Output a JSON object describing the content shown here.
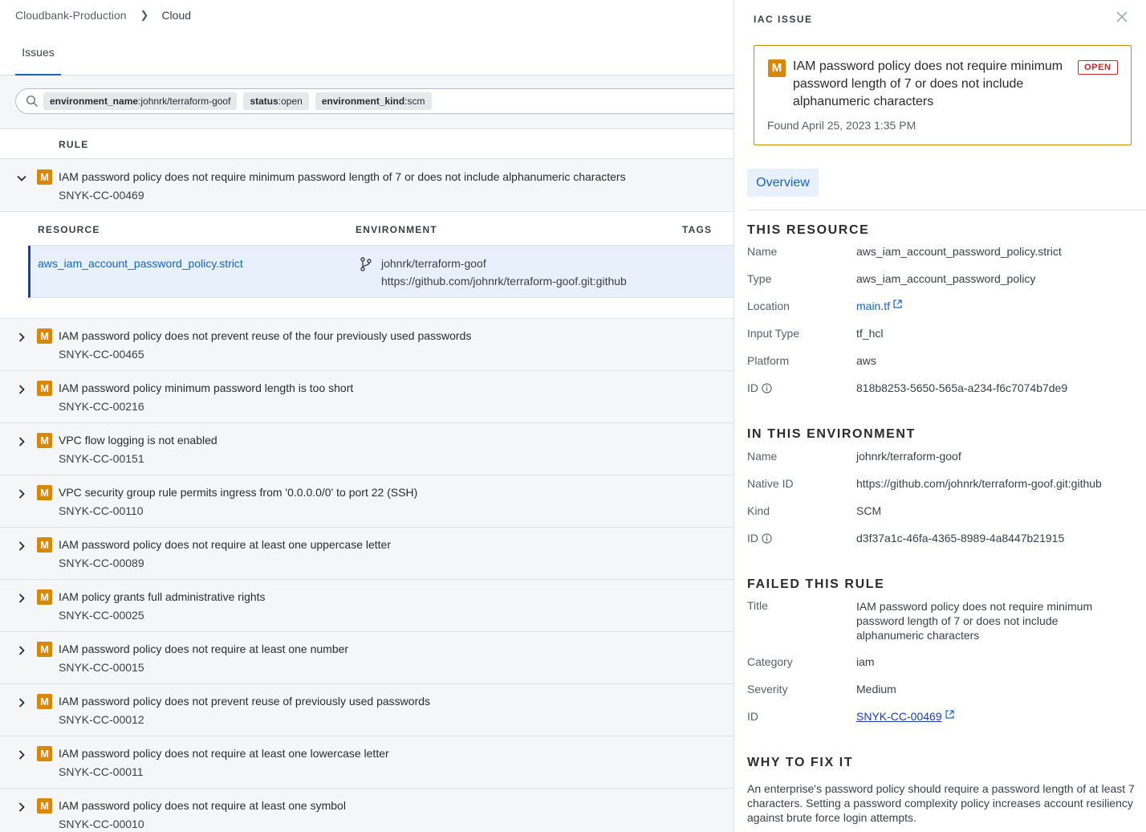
{
  "breadcrumb": {
    "org": "Cloudbank-Production",
    "page": "Cloud"
  },
  "tabs": {
    "issues": "Issues"
  },
  "filters": [
    {
      "key": "environment_name",
      "value": ":johnrk/terraform-goof"
    },
    {
      "key": "status",
      "value": ":open"
    },
    {
      "key": "environment_kind",
      "value": ":scm"
    }
  ],
  "table": {
    "rule_header": "RULE"
  },
  "expanded_rule": {
    "severity": "M",
    "title": "IAM password policy does not require minimum password length of 7 or does not include alphanumeric characters",
    "id": "SNYK-CC-00469",
    "headers": {
      "resource": "RESOURCE",
      "environment": "ENVIRONMENT",
      "tags": "TAGS"
    },
    "resource": "aws_iam_account_password_policy.strict",
    "env_name": "johnrk/terraform-goof",
    "env_url": "https://github.com/johnrk/terraform-goof.git:github"
  },
  "rules": [
    {
      "severity": "M",
      "title": "IAM password policy does not prevent reuse of the four previously used passwords",
      "id": "SNYK-CC-00465"
    },
    {
      "severity": "M",
      "title": "IAM password policy minimum password length is too short",
      "id": "SNYK-CC-00216"
    },
    {
      "severity": "M",
      "title": "VPC flow logging is not enabled",
      "id": "SNYK-CC-00151"
    },
    {
      "severity": "M",
      "title": "VPC security group rule permits ingress from '0.0.0.0/0' to port 22 (SSH)",
      "id": "SNYK-CC-00110"
    },
    {
      "severity": "M",
      "title": "IAM password policy does not require at least one uppercase letter",
      "id": "SNYK-CC-00089"
    },
    {
      "severity": "M",
      "title": "IAM policy grants full administrative rights",
      "id": "SNYK-CC-00025"
    },
    {
      "severity": "M",
      "title": "IAM password policy does not require at least one number",
      "id": "SNYK-CC-00015"
    },
    {
      "severity": "M",
      "title": "IAM password policy does not prevent reuse of previously used passwords",
      "id": "SNYK-CC-00012"
    },
    {
      "severity": "M",
      "title": "IAM password policy does not require at least one lowercase letter",
      "id": "SNYK-CC-00011"
    },
    {
      "severity": "M",
      "title": "IAM password policy does not require at least one symbol",
      "id": "SNYK-CC-00010"
    }
  ],
  "panel": {
    "title": "IAC ISSUE",
    "severity": "M",
    "headline": "IAM password policy does not require minimum password length of 7 or does not include alphanumeric characters",
    "status": "OPEN",
    "found": "Found April 25, 2023 1:35 PM",
    "overview_tab": "Overview",
    "this_resource": {
      "heading": "THIS RESOURCE",
      "name_label": "Name",
      "name": "aws_iam_account_password_policy.strict",
      "type_label": "Type",
      "type": "aws_iam_account_password_policy",
      "location_label": "Location",
      "location": "main.tf",
      "input_type_label": "Input Type",
      "input_type": "tf_hcl",
      "platform_label": "Platform",
      "platform": "aws",
      "id_label": "ID",
      "id": "818b8253-5650-565a-a234-f6c7074b7de9"
    },
    "environment": {
      "heading": "IN THIS ENVIRONMENT",
      "name_label": "Name",
      "name": "johnrk/terraform-goof",
      "native_id_label": "Native ID",
      "native_id": "https://github.com/johnrk/terraform-goof.git:github",
      "kind_label": "Kind",
      "kind": "SCM",
      "id_label": "ID",
      "id": "d3f37a1c-46fa-4365-8989-4a8447b21915"
    },
    "failed_rule": {
      "heading": "FAILED THIS RULE",
      "title_label": "Title",
      "title": "IAM password policy does not require minimum password length of 7 or does not include alphanumeric characters",
      "category_label": "Category",
      "category": "iam",
      "severity_label": "Severity",
      "severity": "Medium",
      "id_label": "ID",
      "id": "SNYK-CC-00469"
    },
    "why": {
      "heading": "WHY TO FIX IT",
      "text": "An enterprise's password policy should require a password length of at least 7 characters. Setting a password complexity policy increases account resiliency against brute force login attempts."
    }
  },
  "colors": {
    "accent": "#1565c0",
    "severity_medium": "#d6880a",
    "open_badge": "#c62828"
  }
}
